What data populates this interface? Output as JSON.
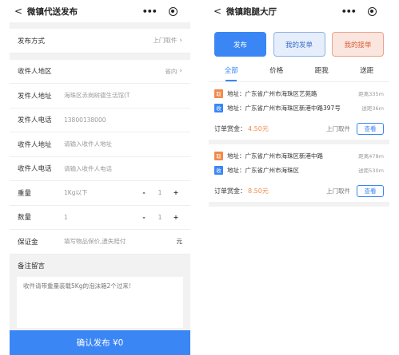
{
  "left": {
    "title": "微镇代送发布",
    "back": "<",
    "more": "•••",
    "publish_method": {
      "label": "发布方式",
      "value": "上门取件"
    },
    "recv_area": {
      "label": "收件人地区",
      "value": "省内"
    },
    "sender_addr": {
      "label": "发件人地址",
      "value": "海珠区赤岗树德生活馆(T"
    },
    "sender_phone": {
      "label": "发件人电话",
      "value": "13800138000"
    },
    "recv_addr": {
      "label": "收件人地址",
      "placeholder": "请输入收件人地址"
    },
    "recv_phone": {
      "label": "收件人电话",
      "placeholder": "请输入收件人电话"
    },
    "weight": {
      "label": "重量",
      "unit": "1Kg以下",
      "minus": "-",
      "qty": "1",
      "plus": "+"
    },
    "quantity": {
      "label": "数量",
      "unit": "1",
      "minus": "-",
      "qty": "1",
      "plus": "+"
    },
    "deposit": {
      "label": "保证金",
      "placeholder": "填写物品保价,遗失赔付",
      "unit": "元"
    },
    "remark": {
      "label": "备注留言",
      "text": "收件请带重量装载5Kg的泡沫箱2个过来!"
    },
    "submit": "确认发布 ¥0"
  },
  "right": {
    "title": "微镇跑腿大厅",
    "back": "<",
    "more": "•••",
    "buttons": {
      "publish": "发布",
      "my_orders": "我的发单",
      "my_takes": "我的接单"
    },
    "tabs": [
      "全部",
      "价格",
      "距我",
      "送距"
    ],
    "orders": [
      {
        "take_tag": "取",
        "take_addr": "地址：广东省广州市海珠区艺苑路",
        "take_dist": "距离335m",
        "recv_tag": "收",
        "recv_addr": "地址：广东省广州市海珠区新港中路397号",
        "recv_dist": "送距36m",
        "reward_label": "订单赏金：",
        "reward": "4.50元",
        "type": "上门取件",
        "view": "查看"
      },
      {
        "take_tag": "取",
        "take_addr": "地址：广东省广州市海珠区新港中路",
        "take_dist": "距离478m",
        "recv_tag": "收",
        "recv_addr": "地址：广东省广州市海珠区",
        "recv_dist": "送距530m",
        "reward_label": "订单赏金：",
        "reward": "8.50元",
        "type": "上门取件",
        "view": "查看"
      }
    ]
  },
  "colors": {
    "accent": "#3a86f5",
    "orange": "#f08a4b",
    "bg": "#f2f2f2"
  }
}
